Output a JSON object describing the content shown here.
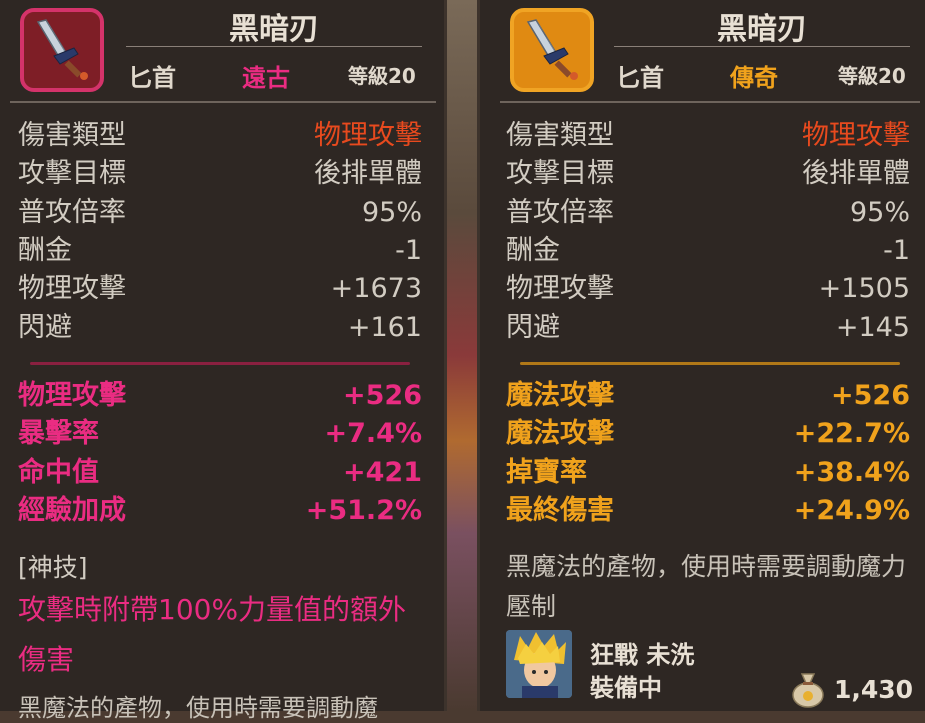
{
  "left_card": {
    "item_name": "黑暗刃",
    "item_type": "匕首",
    "rarity": "遠古",
    "rarity_color": "#ea2c82",
    "level": "等級20",
    "stats": [
      {
        "label": "傷害類型",
        "value": "物理攻擊"
      },
      {
        "label": "攻擊目標",
        "value": "後排單體"
      },
      {
        "label": "普攻倍率",
        "value": "95%"
      },
      {
        "label": "酬金",
        "value": "-1"
      },
      {
        "label": "物理攻擊",
        "value": "+1673"
      },
      {
        "label": "閃避",
        "value": "+161"
      }
    ],
    "bonuses": [
      {
        "label": "物理攻擊",
        "value": "+526"
      },
      {
        "label": "暴擊率",
        "value": "+7.4%"
      },
      {
        "label": "命中值",
        "value": "+421"
      },
      {
        "label": "經驗加成",
        "value": "+51.2%"
      }
    ],
    "skill_tag": "[神技]",
    "skill_text": "攻擊時附帶100%力量值的額外傷害",
    "description_peek": "黑魔法的產物，使用時需要調動魔"
  },
  "right_card": {
    "item_name": "黑暗刃",
    "item_type": "匕首",
    "rarity": "傳奇",
    "rarity_color": "#f0a21c",
    "level": "等級20",
    "stats": [
      {
        "label": "傷害類型",
        "value": "物理攻擊"
      },
      {
        "label": "攻擊目標",
        "value": "後排單體"
      },
      {
        "label": "普攻倍率",
        "value": "95%"
      },
      {
        "label": "酬金",
        "value": "-1"
      },
      {
        "label": "物理攻擊",
        "value": "+1505"
      },
      {
        "label": "閃避",
        "value": "+145"
      }
    ],
    "bonuses": [
      {
        "label": "魔法攻擊",
        "value": "+526"
      },
      {
        "label": "魔法攻擊",
        "value": "+22.7%"
      },
      {
        "label": "掉寶率",
        "value": "+38.4%"
      },
      {
        "label": "最終傷害",
        "value": "+24.9%"
      }
    ],
    "description": "黑魔法的產物，使用時需要調動魔力壓制",
    "equipped_by": "狂戰 未洗",
    "equip_status": "裝備中",
    "price": "1,430"
  },
  "icons": {
    "item_icon": "dagger-icon",
    "coin_icon": "coin-bag-icon",
    "portrait": "hero-avatar"
  }
}
